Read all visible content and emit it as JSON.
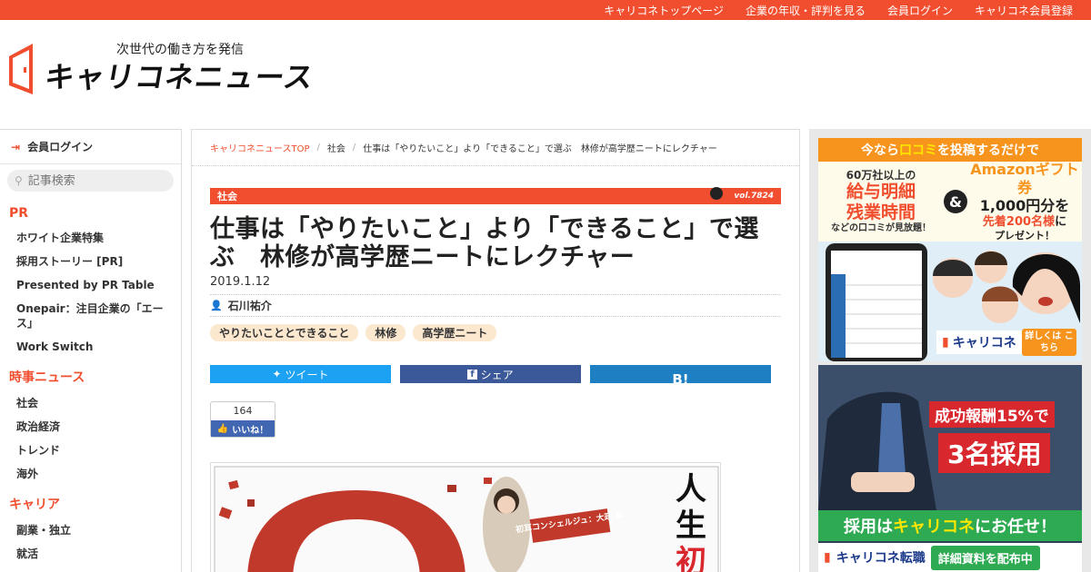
{
  "header": {
    "top_links": [
      "キャリコネトップページ",
      "企業の年収・評判を見る",
      "会員ログイン",
      "キャリコネ会員登録"
    ],
    "tagline": "次世代の働き方を発信",
    "logo_text": "キャリコネニュース"
  },
  "sidebar": {
    "login_label": "会員ログイン",
    "search_placeholder": "記事検索",
    "sections": [
      {
        "title": "PR",
        "items": [
          "ホワイト企業特集",
          "採用ストーリー [PR]",
          "Presented by PR Table",
          "Onepair：注目企業の「エース」",
          "Work Switch"
        ]
      },
      {
        "title": "時事ニュース",
        "items": [
          "社会",
          "政治経済",
          "トレンド",
          "海外"
        ]
      },
      {
        "title": "キャリア",
        "items": [
          "副業・独立",
          "就活"
        ]
      }
    ]
  },
  "breadcrumb": {
    "home": "キャリコネニュースTOP",
    "category": "社会",
    "current": "仕事は「やりたいこと」より「できること」で選ぶ　林修が高学歴ニートにレクチャー"
  },
  "article": {
    "category": "社会",
    "vol": "vol.7824",
    "title": "仕事は「やりたいこと」より「できること」で選ぶ　林修が高学歴ニートにレクチャー",
    "date": "2019.1.12",
    "author": "石川祐介",
    "tags": [
      "やりたいこととできること",
      "林修",
      "高学歴ニート"
    ],
    "share": {
      "tweet": "ツイート",
      "share": "シェア",
      "hatena": "B!"
    },
    "like": {
      "count": "164",
      "label": "いいね！"
    },
    "hero": {
      "caption": "初耳コンシェルジュ：大政 絢",
      "vertical_text": "人生初"
    }
  },
  "ads": {
    "ad1": {
      "headline_pre": "今なら",
      "headline_hl": "口コミ",
      "headline_post": "を投稿するだけで",
      "left_small": "60万社以上の",
      "left_big1": "給与明細",
      "left_big2": "残業時間",
      "left_small2": "などの口コミが見放題！",
      "amp": "&",
      "right_brand": "Amazonギフト券",
      "right_amount": "1,000円分を",
      "right_cond_hl": "先着200名様",
      "right_cond_post": "に",
      "right_present": "プレゼント！",
      "logo": "キャリコネ",
      "logo_sub": "Career Connection",
      "more": "詳しくは こちら"
    },
    "ad2": {
      "line1": "成功報酬15%で",
      "line2": "3名採用",
      "banner_pre": "採用は",
      "banner_hl": "キャリコネ",
      "banner_post": "にお任せ！",
      "logo": "キャリコネ転職",
      "cta": "詳細資料を配布中"
    }
  },
  "colors": {
    "brand": "#f04e2f",
    "twitter": "#1da1f2",
    "facebook": "#3b5998",
    "hatena": "#1e7fc2",
    "tag_bg": "#fbe8cf"
  }
}
